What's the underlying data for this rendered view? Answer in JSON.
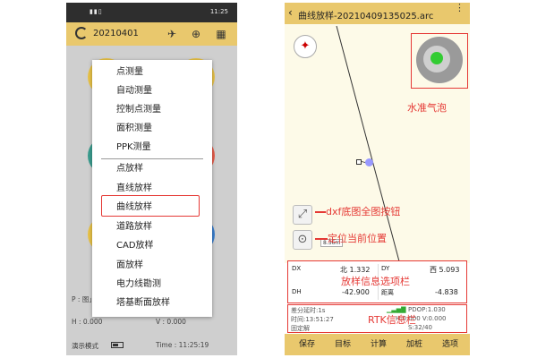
{
  "left_phone": {
    "status_time": "11:25",
    "status_signals": "▮▮▯",
    "app_bar": {
      "date": "20210401"
    },
    "menu": {
      "items": [
        "点测量",
        "自动测量",
        "控制点测量",
        "面积测量",
        "PPK测量",
        "点放样",
        "直线放样",
        "曲线放样",
        "道路放样",
        "CAD放样",
        "面放样",
        "电力线勘测",
        "塔基断面放样"
      ],
      "selected": "曲线放样"
    },
    "bottom": {
      "p_label": "P : 图」",
      "h_label": "H : 0.000",
      "v_label": "V : 0.000",
      "demo_mode": "演示模式",
      "time": "Time : 11:25:19"
    }
  },
  "right_phone": {
    "app_bar": {
      "back": "‹",
      "title": "曲线放样-20210409135025.arc",
      "more": "⋮"
    },
    "map": {
      "scale_label": "8.36m"
    },
    "annotations": {
      "level": "水准气泡",
      "dxf_full": "dxf底图全图按钮",
      "locate": "定位当前位置",
      "stakeout_info": "放样信息选项栏",
      "rtk_info": "RTK信息栏"
    },
    "stakeout": {
      "dx_label": "DX",
      "dx_value": "北 1.332",
      "dy_label": "DY",
      "dy_value": "西 5.093",
      "dh_label": "DH",
      "dh_value": "-42.900",
      "dist_label": "距离",
      "dist_value": "-4.838"
    },
    "rtk": {
      "delay": "差分延时:1s",
      "pdop": "PDOP:1.030",
      "time": "时间:13:51:27",
      "hv": "H:0.000  V:0.000",
      "solution": "固定解",
      "sats": "S:32/40"
    },
    "buttons": [
      "保存",
      "目标",
      "计算",
      "加桩",
      "选项"
    ]
  },
  "colors": {
    "app_bar": "#e9c86d",
    "annotation_red": "#e53935",
    "bubble_green": "#33cc33"
  }
}
